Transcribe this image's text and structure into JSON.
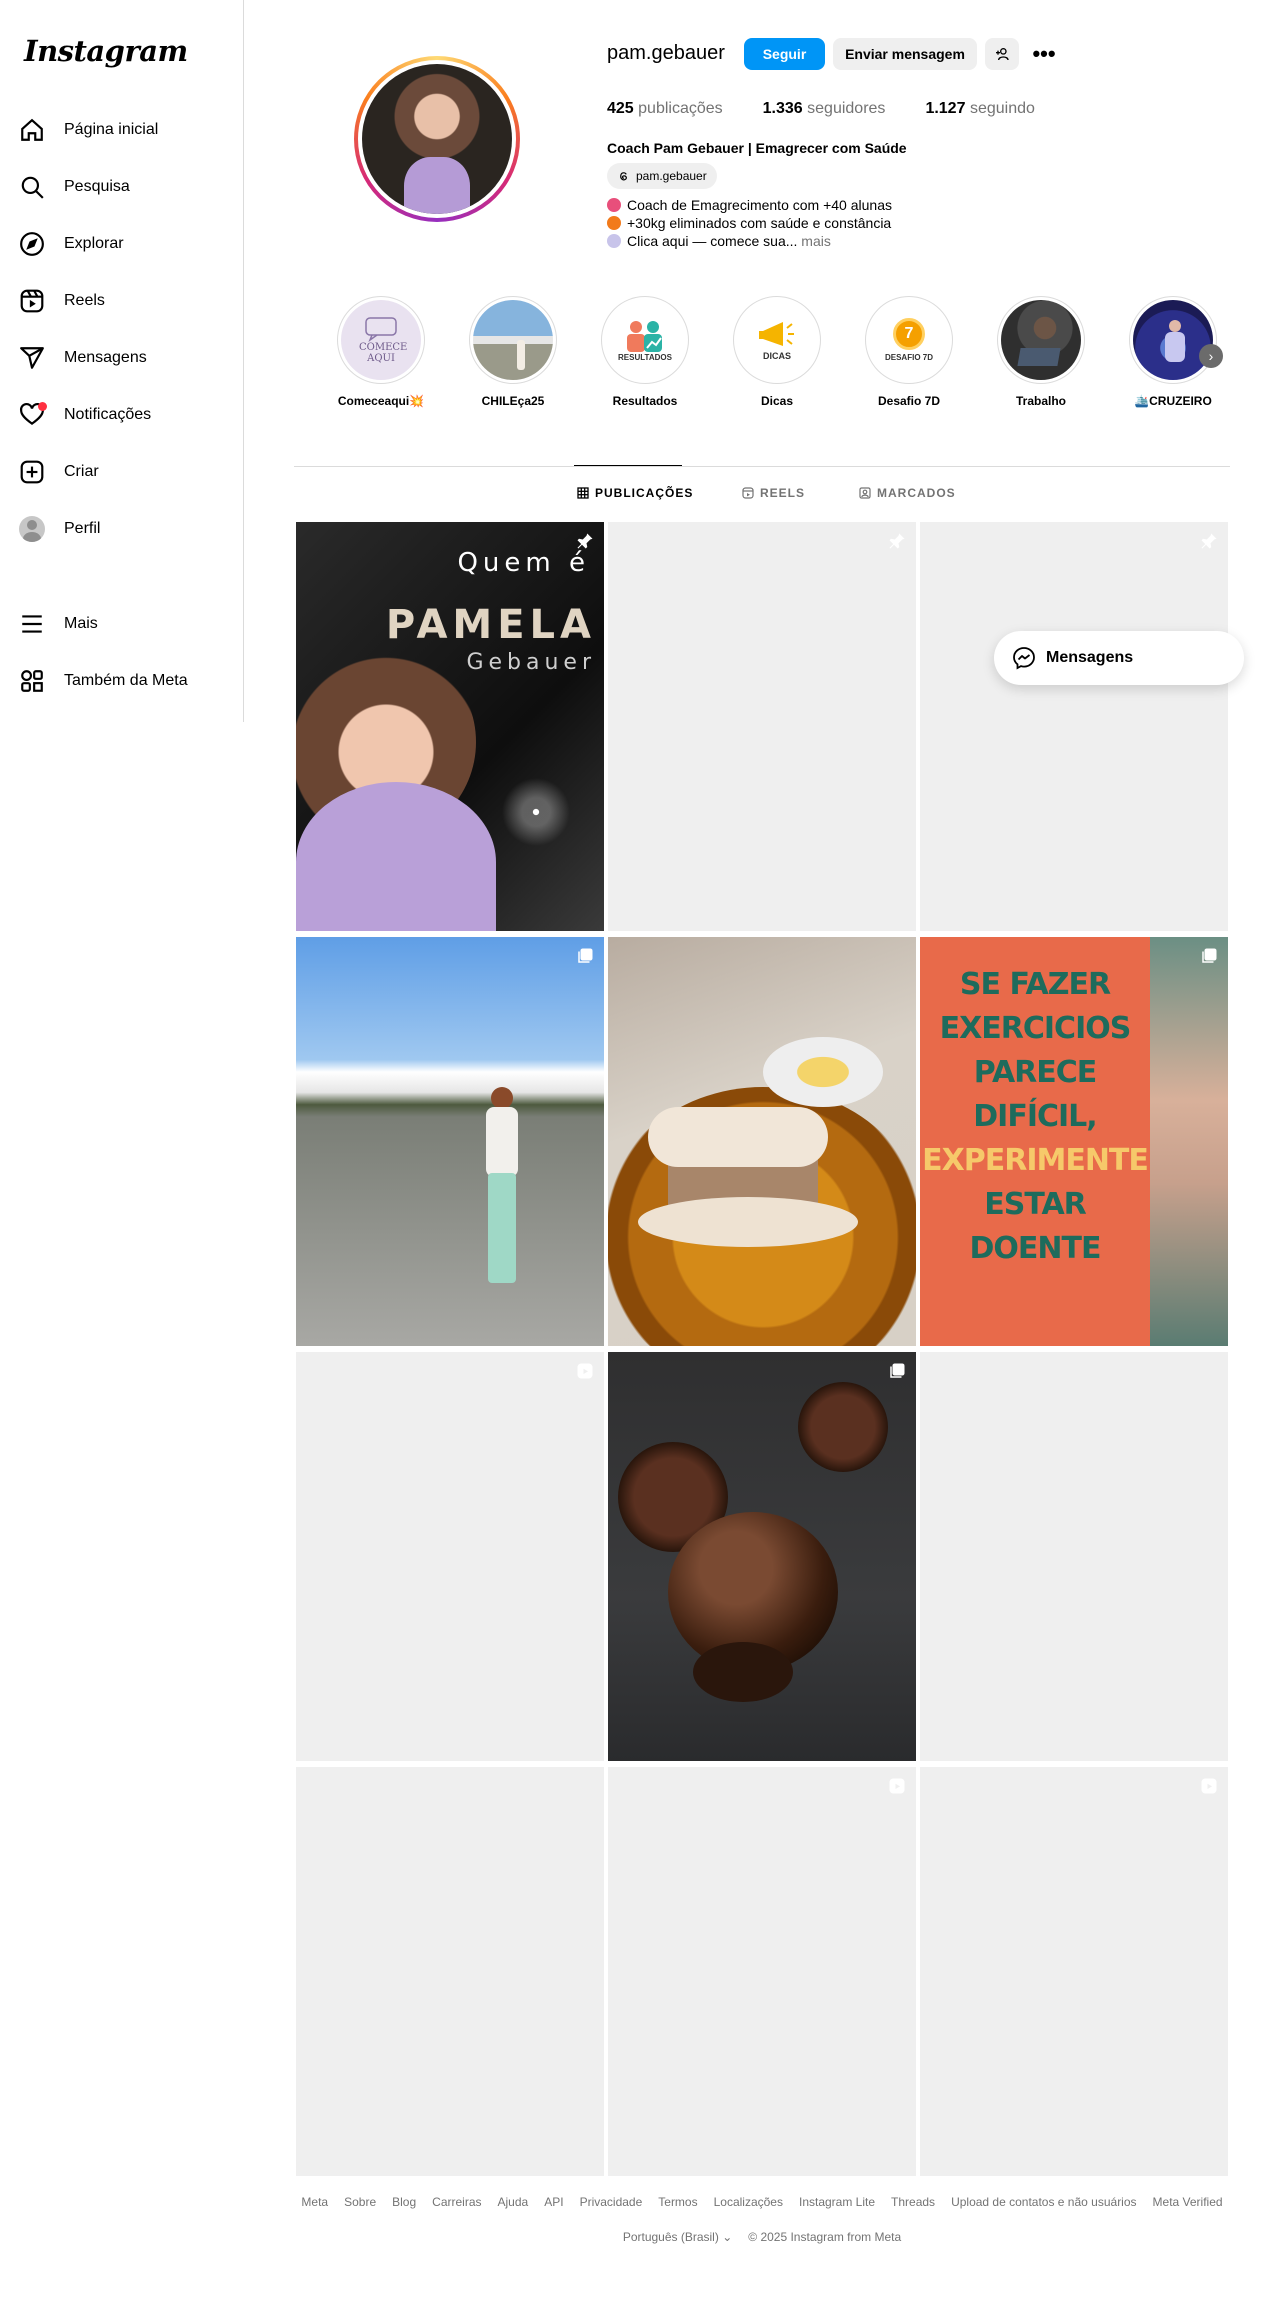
{
  "sidebar": {
    "logo": "Instagram",
    "items": [
      {
        "label": "Página inicial",
        "icon": "home-icon"
      },
      {
        "label": "Pesquisa",
        "icon": "search-icon"
      },
      {
        "label": "Explorar",
        "icon": "compass-icon"
      },
      {
        "label": "Reels",
        "icon": "reels-icon"
      },
      {
        "label": "Mensagens",
        "icon": "send-icon"
      },
      {
        "label": "Notificações",
        "icon": "heart-icon"
      },
      {
        "label": "Criar",
        "icon": "plus-square-icon"
      },
      {
        "label": "Perfil",
        "icon": "avatar"
      }
    ],
    "bottom_items": [
      {
        "label": "Mais",
        "icon": "menu-icon"
      },
      {
        "label": "Também da Meta",
        "icon": "meta-apps-icon"
      }
    ]
  },
  "profile": {
    "username": "pam.gebauer",
    "follow_label": "Seguir",
    "message_label": "Enviar mensagem",
    "more_label": "•••",
    "stats": {
      "posts_count": "425",
      "posts_label": "publicações",
      "followers_count": "1.336",
      "followers_label": "seguidores",
      "following_count": "1.127",
      "following_label": "seguindo"
    },
    "full_name": "Coach Pam Gebauer | Emagrecer com Saúde",
    "threads_handle": "pam.gebauer",
    "bio_lines": [
      "Coach de Emagrecimento com +40 alunas",
      "+30kg eliminados com saúde e constância",
      "Clica aqui — comece sua..."
    ],
    "bio_more": "mais"
  },
  "highlights": [
    {
      "label": "Comeceaqui💥",
      "cover_text": "COMECE AQUI"
    },
    {
      "label": "CHILEça25",
      "cover_text": ""
    },
    {
      "label": "Resultados",
      "cover_text": "RESULTADOS"
    },
    {
      "label": "Dicas",
      "cover_text": "DICAS"
    },
    {
      "label": "Desafio 7D",
      "cover_text": "DESAFIO 7D"
    },
    {
      "label": "Trabalho",
      "cover_text": ""
    },
    {
      "label": "🛳️CRUZEIRO",
      "cover_text": ""
    }
  ],
  "tabs": [
    {
      "label": "PUBLICAÇÕES",
      "active": true
    },
    {
      "label": "REELS",
      "active": false
    },
    {
      "label": "MARCADOS",
      "active": false
    }
  ],
  "posts": {
    "p1": {
      "line1": "Quem é",
      "line2": "PAMELA",
      "line3": "Gebauer"
    },
    "p6": {
      "lines": [
        "SE FAZER",
        "EXERCICIOS",
        "PARECE",
        "DIFÍCIL,",
        "EXPERIMENTE",
        "ESTAR",
        "DOENTE"
      ]
    }
  },
  "floating_messages": {
    "label": "Mensagens"
  },
  "footer": {
    "links": [
      "Meta",
      "Sobre",
      "Blog",
      "Carreiras",
      "Ajuda",
      "API",
      "Privacidade",
      "Termos",
      "Localizações",
      "Instagram Lite",
      "Threads",
      "Upload de contatos e não usuários",
      "Meta Verified"
    ],
    "language": "Português (Brasil)",
    "copyright": "© 2025 Instagram from Meta"
  },
  "colors": {
    "primary": "#0095f6",
    "notification": "#ff3040",
    "muted": "#737373"
  }
}
